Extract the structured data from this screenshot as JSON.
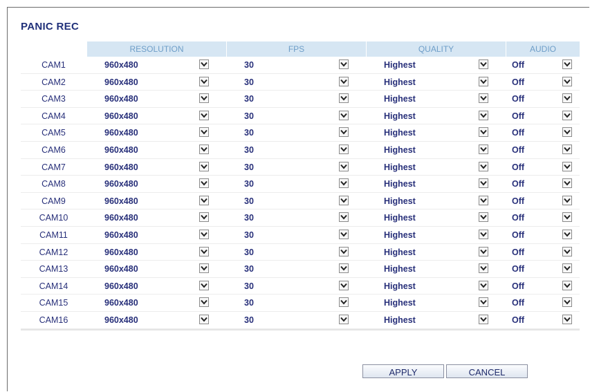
{
  "title": "PANIC REC",
  "columns": {
    "resolution": "RESOLUTION",
    "fps": "FPS",
    "quality": "QUALITY",
    "audio": "AUDIO"
  },
  "rows": [
    {
      "cam": "CAM1",
      "resolution": "960x480",
      "fps": "30",
      "quality": "Highest",
      "audio": "Off"
    },
    {
      "cam": "CAM2",
      "resolution": "960x480",
      "fps": "30",
      "quality": "Highest",
      "audio": "Off"
    },
    {
      "cam": "CAM3",
      "resolution": "960x480",
      "fps": "30",
      "quality": "Highest",
      "audio": "Off"
    },
    {
      "cam": "CAM4",
      "resolution": "960x480",
      "fps": "30",
      "quality": "Highest",
      "audio": "Off"
    },
    {
      "cam": "CAM5",
      "resolution": "960x480",
      "fps": "30",
      "quality": "Highest",
      "audio": "Off"
    },
    {
      "cam": "CAM6",
      "resolution": "960x480",
      "fps": "30",
      "quality": "Highest",
      "audio": "Off"
    },
    {
      "cam": "CAM7",
      "resolution": "960x480",
      "fps": "30",
      "quality": "Highest",
      "audio": "Off"
    },
    {
      "cam": "CAM8",
      "resolution": "960x480",
      "fps": "30",
      "quality": "Highest",
      "audio": "Off"
    },
    {
      "cam": "CAM9",
      "resolution": "960x480",
      "fps": "30",
      "quality": "Highest",
      "audio": "Off"
    },
    {
      "cam": "CAM10",
      "resolution": "960x480",
      "fps": "30",
      "quality": "Highest",
      "audio": "Off"
    },
    {
      "cam": "CAM11",
      "resolution": "960x480",
      "fps": "30",
      "quality": "Highest",
      "audio": "Off"
    },
    {
      "cam": "CAM12",
      "resolution": "960x480",
      "fps": "30",
      "quality": "Highest",
      "audio": "Off"
    },
    {
      "cam": "CAM13",
      "resolution": "960x480",
      "fps": "30",
      "quality": "Highest",
      "audio": "Off"
    },
    {
      "cam": "CAM14",
      "resolution": "960x480",
      "fps": "30",
      "quality": "Highest",
      "audio": "Off"
    },
    {
      "cam": "CAM15",
      "resolution": "960x480",
      "fps": "30",
      "quality": "Highest",
      "audio": "Off"
    },
    {
      "cam": "CAM16",
      "resolution": "960x480",
      "fps": "30",
      "quality": "Highest",
      "audio": "Off"
    }
  ],
  "buttons": {
    "apply": "APPLY",
    "cancel": "CANCEL"
  },
  "icons": {
    "dropdown": "chevron-down-icon"
  }
}
